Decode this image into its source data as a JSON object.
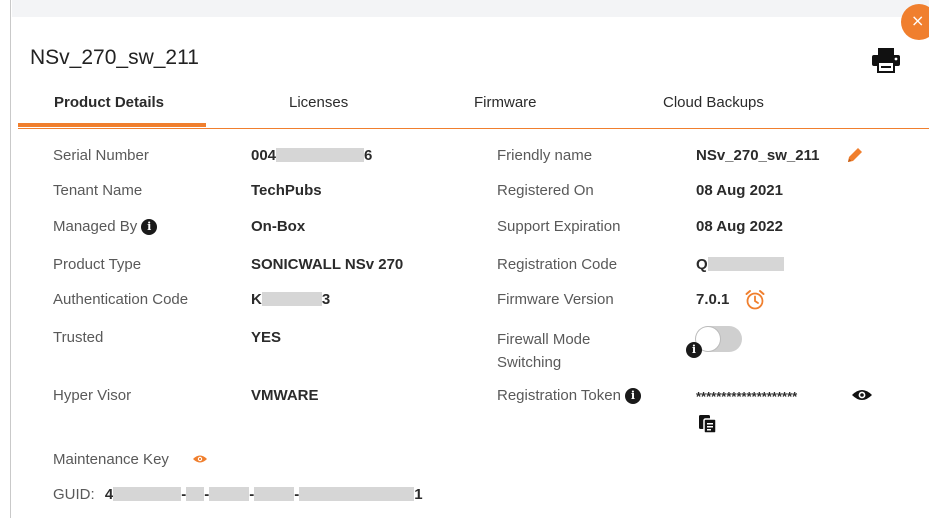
{
  "dialog": {
    "title": "NSv_270_sw_211",
    "close_icon": "×"
  },
  "tabs": [
    {
      "label": "Product Details",
      "active": true
    },
    {
      "label": "Licenses",
      "active": false
    },
    {
      "label": "Firmware",
      "active": false
    },
    {
      "label": "Cloud Backups",
      "active": false
    }
  ],
  "details": {
    "serial_number": {
      "label": "Serial Number",
      "value_prefix": "004",
      "value_suffix": "6"
    },
    "tenant_name": {
      "label": "Tenant Name",
      "value": "TechPubs"
    },
    "managed_by": {
      "label": "Managed By",
      "value": "On-Box"
    },
    "product_type": {
      "label": "Product Type",
      "value": "SONICWALL NSv 270"
    },
    "authentication_code": {
      "label": "Authentication Code",
      "value_prefix": "K",
      "value_suffix": "3"
    },
    "trusted": {
      "label": "Trusted",
      "value": "YES"
    },
    "hyper_visor": {
      "label": "Hyper Visor",
      "value": "VMWARE"
    },
    "maintenance_key": {
      "label": "Maintenance Key"
    },
    "guid": {
      "label": "GUID:",
      "value_prefix": "4",
      "value_suffix": "1"
    },
    "friendly_name": {
      "label": "Friendly name",
      "value": "NSv_270_sw_211"
    },
    "registered_on": {
      "label": "Registered On",
      "value": "08 Aug 2021"
    },
    "support_expiration": {
      "label": "Support Expiration",
      "value": "08 Aug 2022"
    },
    "registration_code": {
      "label": "Registration Code",
      "value_prefix": "Q"
    },
    "firmware_version": {
      "label": "Firmware Version",
      "value": "7.0.1"
    },
    "firewall_mode_switching": {
      "label_line1": "Firewall Mode",
      "label_line2": "Switching",
      "enabled": false
    },
    "registration_token": {
      "label": "Registration Token",
      "value": "********************"
    }
  },
  "info_glyph": "i",
  "colors": {
    "accent": "#f07f2e",
    "text": "#2b2b2b",
    "muted": "#595959",
    "mask": "#d6d6d6"
  },
  "icons": [
    "close-icon",
    "print-icon",
    "info-icon",
    "pencil-icon",
    "alarm-clock-icon",
    "eye-icon",
    "copy-icon"
  ]
}
